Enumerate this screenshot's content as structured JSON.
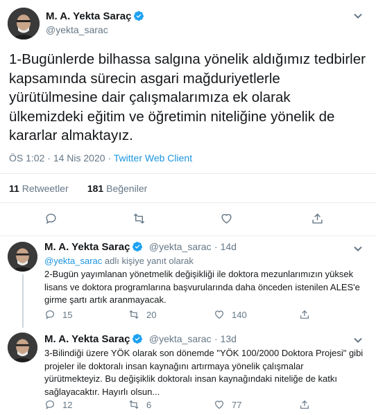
{
  "main_tweet": {
    "author_name": "M. A. Yekta Saraç",
    "author_handle": "@yekta_sarac",
    "text": "1-Bugünlerde bilhassa salgına yönelik aldığımız tedbirler kapsamında sürecin asgari mağduriyetlerle yürütülmesine dair çalışmalarımıza ek olarak ülkemizdeki eğitim ve öğretimin niteliğine yönelik de kararlar almaktayız.",
    "time": "ÖS 1:02",
    "date": "14 Nis 2020",
    "separator": "·",
    "client": "Twitter Web Client",
    "retweet_count": "11",
    "retweet_label": "Retweetler",
    "like_count": "181",
    "like_label": "Beğeniler"
  },
  "replies": [
    {
      "author_name": "M. A. Yekta Saraç",
      "author_handle": "@yekta_sarac",
      "age": "· 14d",
      "replying_mention": "@yekta_sarac",
      "replying_suffix": "adlı kişiye yanıt olarak",
      "text": "2-Bugün yayımlanan yönetmelik değişikliği ile doktora mezunlarımızın yüksek lisans ve doktora programlarına başvurularında daha önceden istenilen ALES'e girme şartı artık aranmayacak.",
      "reply_count": "15",
      "retweet_count": "20",
      "like_count": "140"
    },
    {
      "author_name": "M. A. Yekta Saraç",
      "author_handle": "@yekta_sarac",
      "age": "· 13d",
      "text": "3-Bilindiği üzere YÖK olarak son dönemde \"YÖK 100/2000 Doktora Projesi\" gibi projeler ile doktoralı insan kaynağını artırmaya yönelik çalışmalar yürütmekteyiz. Bu değişiklik doktoralı insan kaynağındaki niteliğe de katkı sağlayacaktır. Hayırlı olsun...",
      "reply_count": "12",
      "retweet_count": "6",
      "like_count": "77"
    }
  ],
  "icons": {
    "verified": "verified-badge-icon",
    "caret": "chevron-down-icon",
    "reply": "reply-icon",
    "retweet": "retweet-icon",
    "like": "heart-icon",
    "share": "share-icon"
  },
  "colors": {
    "accent": "#1da1f2",
    "link": "#1b95e0",
    "muted": "#657786",
    "divider": "#e6ecf0"
  }
}
